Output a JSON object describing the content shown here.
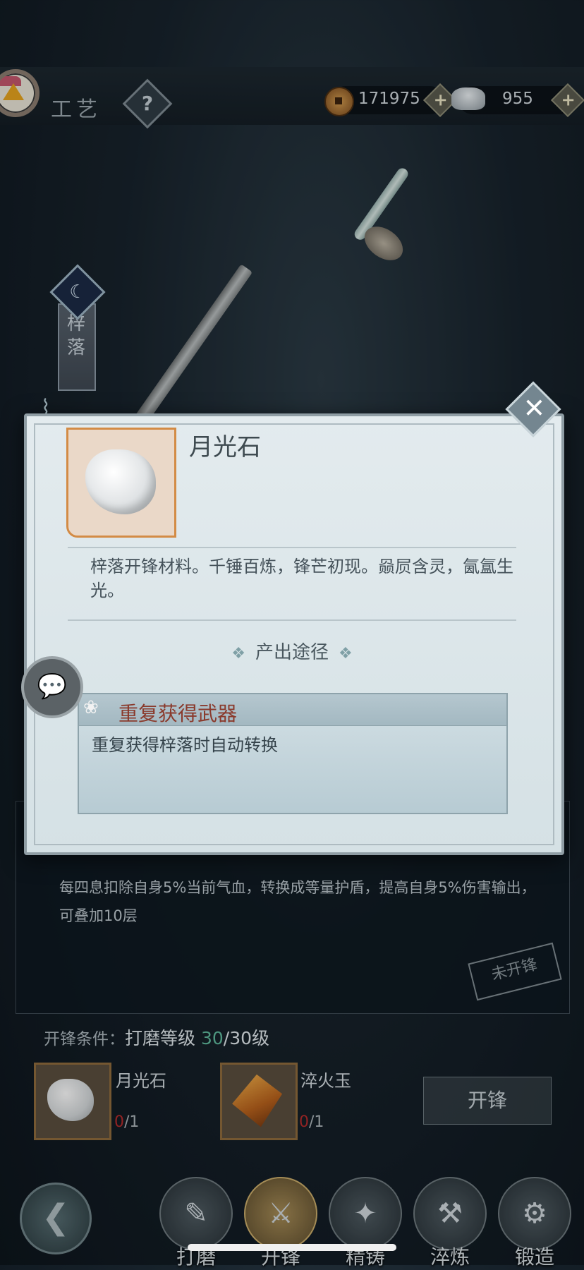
{
  "header": {
    "title": "工艺",
    "help_label": "?",
    "copper": "171975",
    "silver": "955",
    "plus_label": "+"
  },
  "weapon": {
    "name_vertical": "梓落",
    "badge_glyph": "☾"
  },
  "popup": {
    "item_name": "月光石",
    "item_desc": "梓落开锋材料。千锤百炼，锋芒初现。赑屃含灵，氤氲生光。",
    "source_title": "产出途径",
    "source_ornament": "❖",
    "source": {
      "name": "重复获得武器",
      "desc": "重复获得梓落时自动转换"
    },
    "close_glyph": "✕",
    "chat_glyph": "💬"
  },
  "skill": {
    "desc": "每四息扣除自身5%当前气血，转换成等量护盾，提高自身5%伤害输出，可叠加10层",
    "stamp": "未开锋"
  },
  "condition": {
    "label": "开锋条件：",
    "level_label": "打磨等级 ",
    "current": "30",
    "total": "/30级"
  },
  "materials": [
    {
      "name": "月光石",
      "have": "0",
      "need": "/1"
    },
    {
      "name": "淬火玉",
      "have": "0",
      "need": "/1"
    }
  ],
  "action_button": "开锋",
  "nav": {
    "back_glyph": "❮",
    "items": [
      {
        "label": "打磨",
        "glyph": "✎"
      },
      {
        "label": "开锋",
        "glyph": "⚔"
      },
      {
        "label": "精铸",
        "glyph": "✦"
      },
      {
        "label": "淬炼",
        "glyph": "⚒"
      },
      {
        "label": "锻造",
        "glyph": "⚙"
      }
    ]
  },
  "colors": {
    "accent_red": "#8a3a2c",
    "count_red": "#b32b2b",
    "level_green": "#5fb89b"
  }
}
